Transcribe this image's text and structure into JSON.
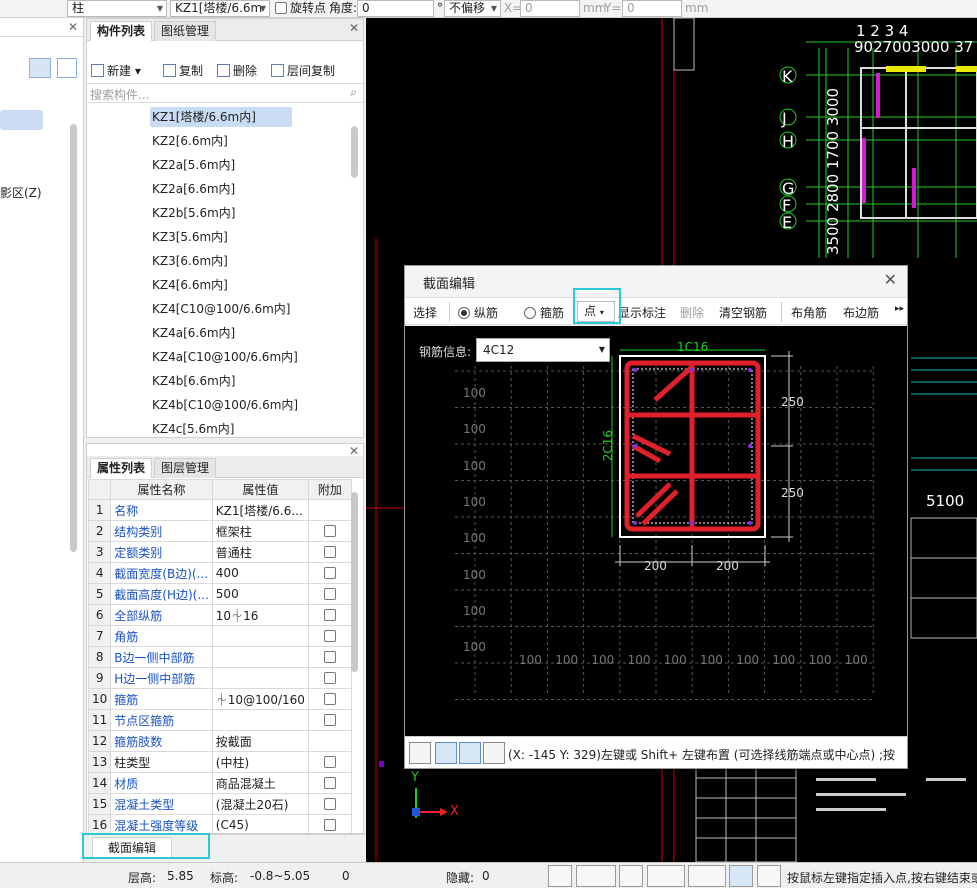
{
  "topbar": {
    "type_select": "柱",
    "component_select": "KZ1[塔楼/6.6m",
    "rotate_label": "旋转点",
    "angle_label": "角度:",
    "angle_value": "0",
    "degree_unit": "°",
    "offset_select": "不偏移",
    "x_label": "X=",
    "x_value": "0",
    "y_label": "Y=",
    "y_value": "0",
    "mm1": "mm",
    "mm2": "mm"
  },
  "leftnav": {
    "shadow_text": "影区(Z)"
  },
  "component_panel": {
    "tabs": [
      "构件列表",
      "图纸管理"
    ],
    "toolbar": {
      "new": "新建",
      "copy": "复制",
      "delete": "删除",
      "floor_copy": "层间复制"
    },
    "search_placeholder": "搜索构件...",
    "items": [
      "KZ1[塔楼/6.6m内]",
      "KZ2[6.6m内]",
      "KZ2a[5.6m内]",
      "KZ2a[6.6m内]",
      "KZ2b[5.6m内]",
      "KZ3[5.6m内]",
      "KZ3[6.6m内]",
      "KZ4[6.6m内]",
      "KZ4[C10@100/6.6m内]",
      "KZ4a[6.6m内]",
      "KZ4a[C10@100/6.6m内]",
      "KZ4b[6.6m内]",
      "KZ4b[C10@100/6.6m内]",
      "KZ4c[5.6m内]"
    ]
  },
  "property_panel": {
    "tabs": [
      "属性列表",
      "图层管理"
    ],
    "headers": {
      "name": "属性名称",
      "value": "属性值",
      "extra": "附加"
    },
    "rows": [
      {
        "no": "1",
        "name": "名称",
        "value": "KZ1[塔楼/6.6...",
        "check": false
      },
      {
        "no": "2",
        "name": "结构类别",
        "value": "框架柱",
        "check": true
      },
      {
        "no": "3",
        "name": "定额类别",
        "value": "普通柱",
        "check": true
      },
      {
        "no": "4",
        "name": "截面宽度(B边)(...",
        "value": "400",
        "check": true
      },
      {
        "no": "5",
        "name": "截面高度(H边)(...",
        "value": "500",
        "check": true
      },
      {
        "no": "6",
        "name": "全部纵筋",
        "value": "10⏆16",
        "check": true
      },
      {
        "no": "7",
        "name": "角筋",
        "value": "",
        "check": true
      },
      {
        "no": "8",
        "name": "B边一侧中部筋",
        "value": "",
        "check": true
      },
      {
        "no": "9",
        "name": "H边一侧中部筋",
        "value": "",
        "check": true
      },
      {
        "no": "10",
        "name": "箍筋",
        "value": "⏆10@100/160",
        "check": true
      },
      {
        "no": "11",
        "name": "节点区箍筋",
        "value": "",
        "check": true
      },
      {
        "no": "12",
        "name": "箍筋肢数",
        "value": "按截面",
        "check": false
      },
      {
        "no": "13",
        "name": "柱类型",
        "value": "(中柱)",
        "check": true
      },
      {
        "no": "14",
        "name": "材质",
        "value": "商品混凝土",
        "check": true
      },
      {
        "no": "15",
        "name": "混凝土类型",
        "value": "(混凝土20石)",
        "check": true
      },
      {
        "no": "16",
        "name": "混凝土强度等级",
        "value": "(C45)",
        "check": true
      }
    ]
  },
  "bottom_tab": "截面编辑",
  "canvas": {
    "top_numbers_1": "1 2     3      4",
    "top_numbers_2": "9027003000 37",
    "axis_labels": [
      "K",
      "J",
      "H",
      "G",
      "F",
      "E"
    ],
    "vertical_dims": "3500 2800 1700 3000",
    "dim_5100": "5100",
    "axis_x": "X",
    "axis_y": "Y"
  },
  "dialog": {
    "title": "截面编辑",
    "toolbar": {
      "select": "选择",
      "longitudinal": "纵筋",
      "stirrup": "箍筋",
      "point": "点",
      "show_label": "显示标注",
      "delete": "删除",
      "clear_rebar": "清空钢筋",
      "corner_bar": "布角筋",
      "side_bar": "布边筋"
    },
    "rebar_info_label": "钢筋信息:",
    "rebar_info_value": "4C12",
    "top_label": "1C16",
    "side_label": "2C16",
    "dim_250_a": "250",
    "dim_250_b": "250",
    "dim_200_a": "200",
    "dim_200_b": "200",
    "grid_left_labels": [
      "100",
      "100",
      "100",
      "100",
      "100",
      "100",
      "100",
      "100"
    ],
    "grid_bottom_labels": [
      "100",
      "100",
      "100",
      "100",
      "100",
      "100",
      "100",
      "100",
      "100",
      "100"
    ],
    "status_text": "(X: -145 Y: 329)左键或 Shift+ 左键布置 (可选择线筋端点或中心点) ;按"
  },
  "statusbar": {
    "floor_height_label": "层高:",
    "floor_height_value": "5.85",
    "elevation_label": "标高:",
    "elevation_value": "-0.8~5.05",
    "zero": "0",
    "hidden_label": "隐藏:",
    "hidden_value": "0",
    "hint": "按鼠标左键指定插入点,按右键结束或"
  },
  "colors": {
    "rebar": "#e0202a",
    "highlight": "#2cc9d6",
    "canvas": "#000000"
  }
}
